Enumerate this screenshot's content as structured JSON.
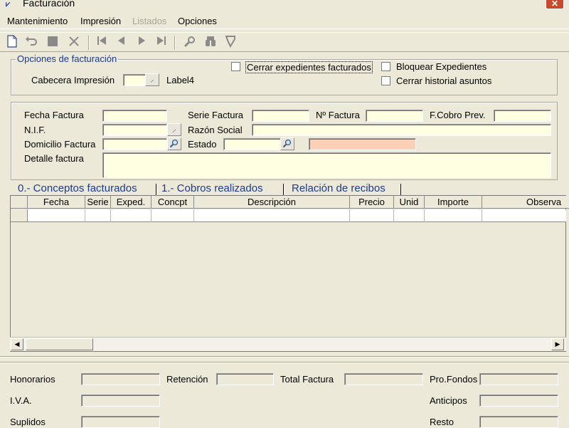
{
  "window": {
    "title": "Facturación",
    "close_symbol": "✕"
  },
  "menu": {
    "mantenimiento": "Mantenimiento",
    "impresion": "Impresión",
    "listados": "Listados",
    "opciones": "Opciones"
  },
  "toolbar": {
    "icons": [
      "new-document-icon",
      "undo-icon",
      "stop-icon",
      "cancel-icon",
      "first-record-icon",
      "previous-record-icon",
      "next-record-icon",
      "last-record-icon",
      "search-icon",
      "binoculars-icon",
      "filter-icon"
    ]
  },
  "options_group": {
    "legend": "Opciones de facturación",
    "cabecera_label": "Cabecera Impresión",
    "cabecera_value": "",
    "label4": "Label4",
    "cerrar_expedientes": "Cerrar expedientes facturados",
    "bloquear_expedientes": "Bloquear Expedientes",
    "cerrar_historial": "Cerrar historial asuntos",
    "cerrar_expedientes_checked": false,
    "bloquear_expedientes_checked": false,
    "cerrar_historial_checked": false
  },
  "invoice": {
    "fecha_label": "Fecha Factura",
    "serie_label": "Serie Factura",
    "numero_label": "Nº Factura",
    "fcobro_label": "F.Cobro Prev.",
    "nif_label": "N.I.F.",
    "razon_label": "Razón Social",
    "domicilio_label": "Domicilio Factura",
    "estado_label": "Estado",
    "detalle_label": "Detalle factura",
    "fecha_value": "",
    "serie_value": "",
    "numero_value": "",
    "fcobro_value": "",
    "nif_value": "",
    "razon_value": "",
    "domicilio_value": "",
    "estado_value": "",
    "estado_desc_value": "",
    "detalle_value": ""
  },
  "tabs": [
    {
      "label": "0.- Conceptos facturados"
    },
    {
      "label": "1.- Cobros realizados"
    },
    {
      "label": "Relación de recibos"
    }
  ],
  "grid": {
    "columns": [
      "Fecha",
      "Serie",
      "Exped.",
      "Concpt",
      "Descripción",
      "Precio",
      "Unid",
      "Importe",
      "Observa"
    ]
  },
  "totals": {
    "honorarios": "Honorarios",
    "retencion": "Retención",
    "total_factura": "Total Factura",
    "pro_fondos": "Pro.Fondos",
    "iva": "I.V.A.",
    "anticipos": "Anticipos",
    "suplidos": "Suplidos",
    "resto": "Resto"
  },
  "colors": {
    "accent_text": "#1c3a8f",
    "field_bg": "#ffffe1",
    "estado_desc_bg": "#fbd0b6",
    "window_bg": "#ece9d8"
  }
}
